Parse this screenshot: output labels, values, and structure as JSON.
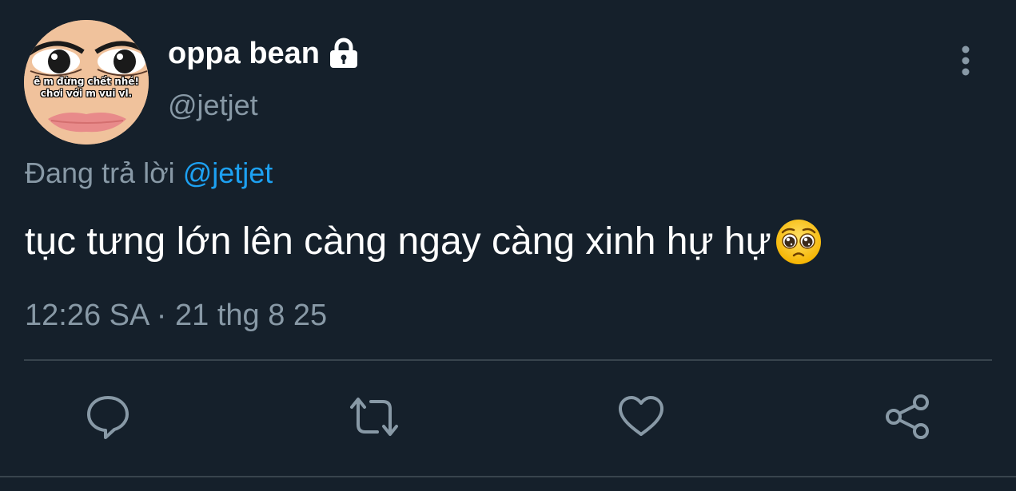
{
  "tweet": {
    "author": {
      "display_name": "oppa bean",
      "handle": "@jetjet",
      "protected": true,
      "avatar_caption_line1": "ê m đừng chết nhé!",
      "avatar_caption_line2": "chơi với m vui vl."
    },
    "reply_prefix": "Đang trả lời",
    "reply_to": "@jetjet",
    "text": "tục tưng lớn lên càng ngay càng xinh hự hự",
    "emoji": "pleading-face",
    "timestamp": "12:26 SA · 21 thg 8 25"
  },
  "icons": {
    "lock": "lock-icon",
    "more": "more-vertical-icon",
    "reply": "reply-icon",
    "retweet": "retweet-icon",
    "like": "heart-icon",
    "share": "share-icon"
  },
  "colors": {
    "background": "#15202b",
    "primary_text": "#ffffff",
    "secondary_text": "#8899a6",
    "link": "#1da1f2",
    "divider": "#38444d"
  }
}
